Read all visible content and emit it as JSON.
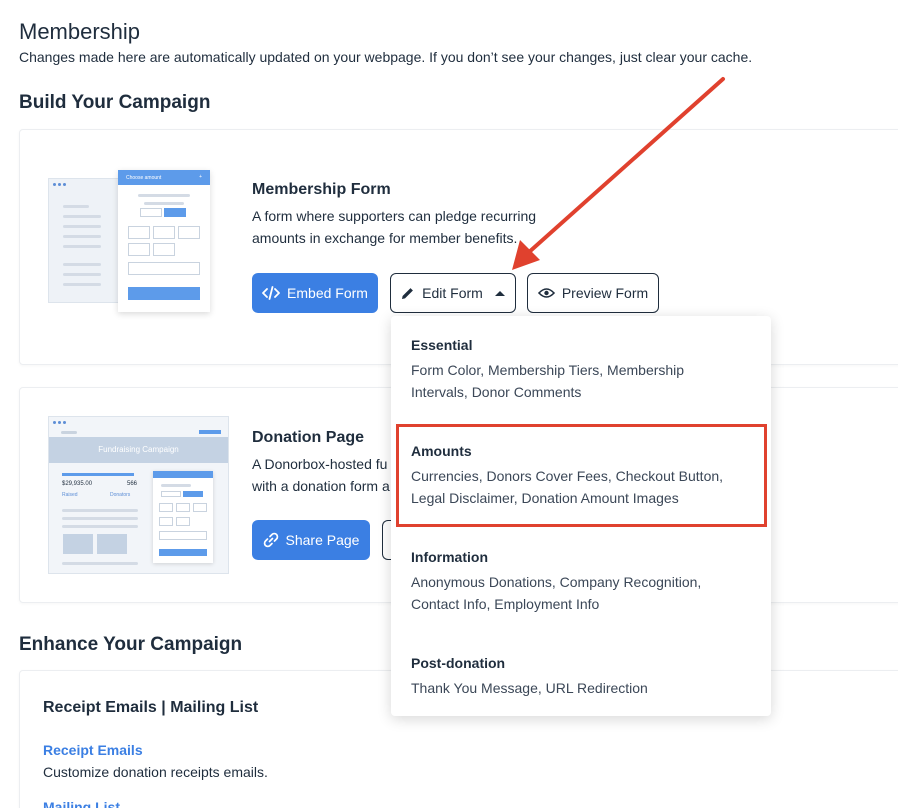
{
  "header": {
    "title": "Membership",
    "subtitle": "Changes made here are automatically updated on your webpage. If you don’t see your changes, just clear your cache."
  },
  "build_section": {
    "title": "Build Your Campaign"
  },
  "membership_form": {
    "title": "Membership Form",
    "description_line1": "A form where supporters can pledge recurring",
    "description_line2": "amounts in exchange for member benefits.",
    "illustration_label": "Choose amount",
    "embed_label": "Embed Form",
    "edit_label": "Edit Form",
    "preview_label": "Preview Form"
  },
  "donation_page": {
    "title": "Donation Page",
    "description_line1": "A Donorbox-hosted fu",
    "description_line2": "with a donation form a",
    "illustration_banner": "Fundraising Campaign",
    "illustration_raised": "$29,935.00",
    "illustration_raised_label": "Raised",
    "illustration_donors": "566",
    "illustration_donors_label": "Donators",
    "share_label": "Share Page"
  },
  "edit_menu": {
    "items": [
      {
        "heading": "Essential",
        "line1": "Form Color, Membership Tiers, Membership",
        "line2": "Intervals, Donor Comments"
      },
      {
        "heading": "Amounts",
        "line1": "Currencies, Donors Cover Fees, Checkout Button,",
        "line2": "Legal Disclaimer, Donation Amount Images"
      },
      {
        "heading": "Information",
        "line1": "Anonymous Donations, Company Recognition,",
        "line2": "Contact Info, Employment Info"
      },
      {
        "heading": "Post-donation",
        "line1": "Thank You Message, URL Redirection",
        "line2": ""
      }
    ]
  },
  "enhance_section": {
    "title": "Enhance Your Campaign",
    "card_title": "Receipt Emails | Mailing List",
    "receipt_link": "Receipt Emails",
    "receipt_desc": "Customize donation receipts emails.",
    "mailing_link": "Mailing List"
  },
  "colors": {
    "primary": "#3b7fe3",
    "text": "#1f2d3d",
    "highlight": "#e0412e",
    "arrow": "#e0412e"
  }
}
